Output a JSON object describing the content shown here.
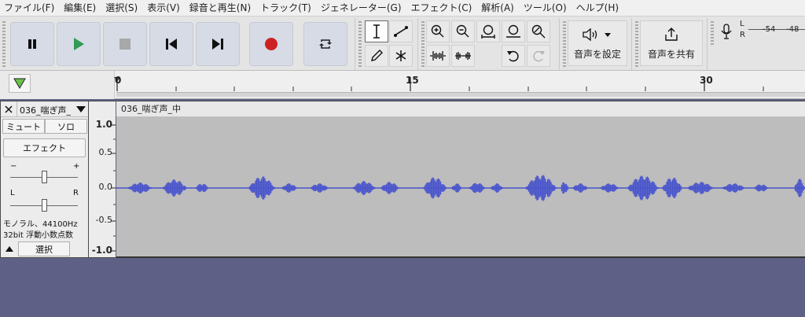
{
  "menu": [
    "ファイル(F)",
    "編集(E)",
    "選択(S)",
    "表示(V)",
    "録音と再生(N)",
    "トラック(T)",
    "ジェネレーター(G)",
    "エフェクト(C)",
    "解析(A)",
    "ツール(O)",
    "ヘルプ(H)"
  ],
  "toolbar": {
    "audio_setup_label": "音声を設定",
    "share_audio_label": "音声を共有"
  },
  "meter": {
    "left_channel": "L",
    "right_channel": "R",
    "scale": [
      "-54",
      "-48"
    ]
  },
  "timeline": {
    "labels": [
      "0",
      "15",
      "30"
    ]
  },
  "track": {
    "name": "036_喘ぎ声_",
    "clip_name": "036_喘ぎ声_中",
    "mute_label": "ミュート",
    "solo_label": "ソロ",
    "effects_label": "エフェクト",
    "gain_minus": "−",
    "gain_plus": "+",
    "pan_left": "L",
    "pan_right": "R",
    "info_line1": "モノラル、44100Hz",
    "info_line2": "32bit 浮動小数点数",
    "select_label": "選択",
    "scale": [
      "1.0",
      "0.5",
      "0.0",
      "-0.5",
      "-1.0"
    ]
  },
  "colors": {
    "waveform": "#4a55cc",
    "workspace": "#5e6185",
    "track_background": "#bdbdbd",
    "record_button": "#cc2222",
    "play_button": "#2f9a55"
  }
}
